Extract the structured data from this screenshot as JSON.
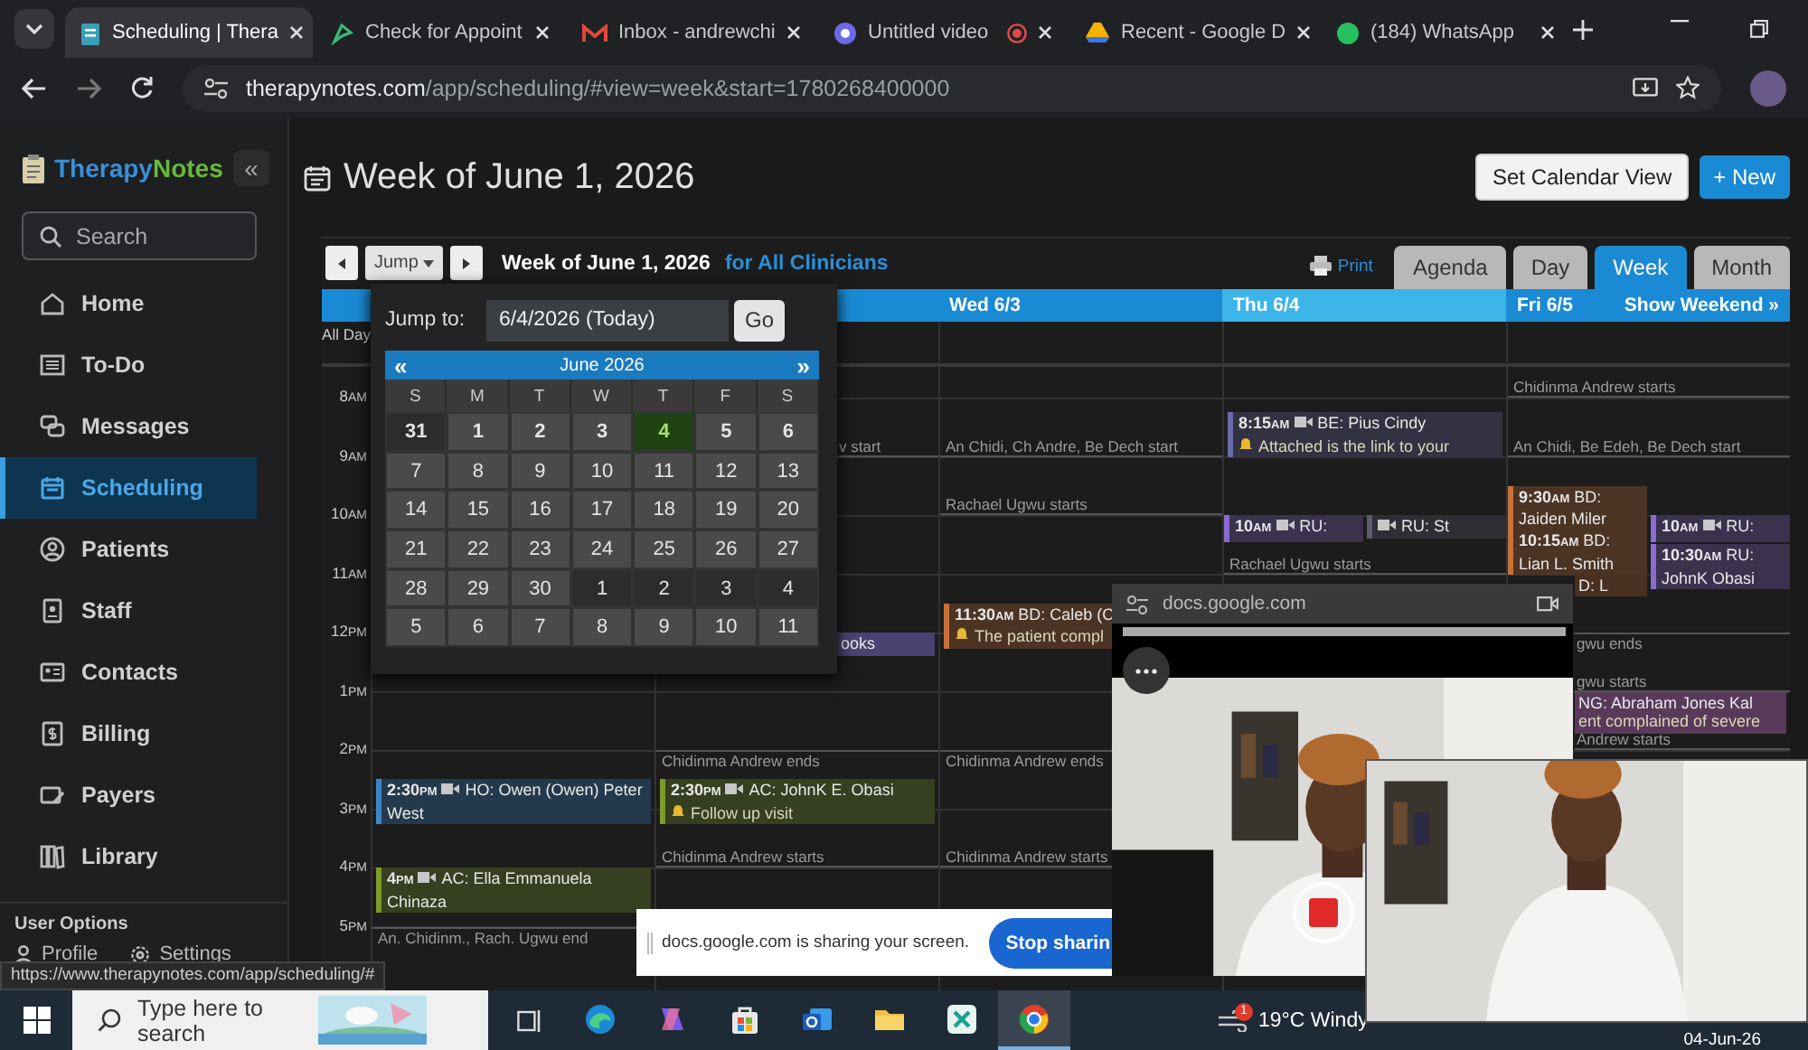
{
  "browser": {
    "tabs": [
      {
        "label": "Scheduling | Thera",
        "selected": true
      },
      {
        "label": "Check for Appoint",
        "selected": false
      },
      {
        "label": "Inbox - andrewchi",
        "selected": false
      },
      {
        "label": "Untitled video",
        "selected": false
      },
      {
        "label": "Recent - Google D",
        "selected": false
      },
      {
        "label": "(184) WhatsApp",
        "selected": false
      }
    ],
    "url_host": "therapynotes.com",
    "url_path": "/app/scheduling/#view=week&start=1780268400000"
  },
  "sidebar": {
    "logo": [
      "Therapy",
      "Notes"
    ],
    "collapse": "«",
    "search_placeholder": "Search",
    "items": [
      {
        "label": "Home",
        "selected": false
      },
      {
        "label": "To-Do",
        "selected": false
      },
      {
        "label": "Messages",
        "selected": false
      },
      {
        "label": "Scheduling",
        "selected": true
      },
      {
        "label": "Patients",
        "selected": false
      },
      {
        "label": "Staff",
        "selected": false
      },
      {
        "label": "Contacts",
        "selected": false
      },
      {
        "label": "Billing",
        "selected": false
      },
      {
        "label": "Payers",
        "selected": false
      },
      {
        "label": "Library",
        "selected": false
      }
    ],
    "section": "User Options",
    "links": [
      "Profile",
      "Settings"
    ]
  },
  "header": {
    "title": "Week of June 1, 2026",
    "buttons": [
      {
        "label": "Set Calendar View",
        "kind": "secondary"
      },
      {
        "label": "+ New",
        "kind": "primary"
      }
    ]
  },
  "calendar": {
    "jump": "Jump",
    "title": "Week of June 1, 2026",
    "scope": "for All Clinicians",
    "print": "Print",
    "views": [
      {
        "label": "Agenda",
        "selected": false
      },
      {
        "label": "Day",
        "selected": false
      },
      {
        "label": "Week",
        "selected": true
      },
      {
        "label": "Month",
        "selected": false
      }
    ],
    "days": [
      {
        "label": "Wed 6/3",
        "today": false
      },
      {
        "label": "Thu 6/4",
        "today": true
      },
      {
        "label": "Fri 6/5",
        "today": false
      }
    ],
    "show_weekend": "Show Weekend »",
    "all_day": "All Day",
    "hours": [
      {
        "hour": "8",
        "meridiem": "AM",
        "cells": {
          "column_4": [
            {
              "kind": "appt",
              "time": "8:15",
              "meridiem": "AM",
              "video": true,
              "title": "BE: Pius Cindy",
              "note": "Attached is the link to your",
              "color": "#6a6aa8",
              "clipped": false
            }
          ],
          "column_5": [
            {
              "kind": "start",
              "text": "Chidinma Andrew starts",
              "clipped": false
            }
          ]
        }
      },
      {
        "hour": "9",
        "meridiem": "AM",
        "cells": {
          "column_2": [
            {
              "kind": "start",
              "text": "v start",
              "clipped": true
            }
          ],
          "column_3": [
            {
              "kind": "start",
              "text": "An Chidi, Ch Andre, Be Dech start",
              "clipped": false
            }
          ],
          "column_5": [
            {
              "kind": "start",
              "text": "An Chidi, Be Edeh, Be Dech start",
              "clipped": false
            },
            {
              "kind": "overlap",
              "lanes": [
                [
                  {
                    "kind": "appt",
                    "time": "9:30",
                    "meridiem": "AM",
                    "video": false,
                    "title": "BD: Jaiden Miler",
                    "color": "#c8703a",
                    "clipped": false
                  },
                  {
                    "kind": "appt",
                    "time": "10:15",
                    "meridiem": "AM",
                    "video": false,
                    "title": "BD: Lian L. Smith",
                    "color": "#c8703a",
                    "clipped": false
                  },
                  {
                    "kind": "appt",
                    "video": false,
                    "title": "D: L",
                    "color": "#4a3020",
                    "clipped": true
                  }
                ],
                [
                  {
                    "kind": "appt",
                    "time": "10",
                    "meridiem": "AM",
                    "video": true,
                    "title": "RU:",
                    "color": "#8a6ad0",
                    "clipped": false
                  },
                  {
                    "kind": "appt",
                    "time": "10:30",
                    "meridiem": "AM",
                    "video": false,
                    "title": "RU: JohnK Obasi",
                    "color": "#8a6ad0",
                    "clipped": false
                  }
                ]
              ]
            }
          ]
        }
      },
      {
        "hour": "10",
        "meridiem": "AM",
        "cells": {
          "column_3": [
            {
              "kind": "start",
              "text": "Rachael Ugwu starts",
              "clipped": false
            }
          ],
          "column_4": [
            {
              "kind": "overlap",
              "lanes": [
                [
                  {
                    "kind": "appt",
                    "time": "10",
                    "meridiem": "AM",
                    "video": true,
                    "title": "RU:",
                    "color": "#8a6ad0",
                    "clipped": false
                  }
                ],
                [
                  {
                    "kind": "appt",
                    "video": true,
                    "title": "RU: St",
                    "color": "#5c5c72",
                    "clipped": false
                  }
                ]
              ]
            }
          ]
        }
      },
      {
        "hour": "11",
        "meridiem": "AM",
        "cells": {
          "column_3": [
            {
              "kind": "appt",
              "time": "11:30",
              "meridiem": "AM",
              "video": false,
              "title": "BD: Caleb (C",
              "note": "The patient compl",
              "color": "#c8703a",
              "clipped": false
            }
          ],
          "column_4": [
            {
              "kind": "start",
              "text": "Rachael Ugwu starts",
              "clipped": false
            }
          ]
        }
      },
      {
        "hour": "12",
        "meridiem": "PM",
        "cells": {
          "column_2": [
            {
              "kind": "appt",
              "video": false,
              "title": "ooks",
              "color": "#4a4270",
              "clipped": true
            }
          ],
          "column_5": [
            {
              "kind": "end",
              "text": "gwu ends",
              "clipped": true
            }
          ]
        }
      },
      {
        "hour": "1",
        "meridiem": "PM",
        "cells": {
          "column_5": [
            {
              "kind": "start",
              "text": "gwu starts",
              "clipped": true
            },
            {
              "kind": "appt",
              "video": false,
              "title": "NG: Abraham Jones Kal",
              "note": "ent complained of severe",
              "color": "#5a3a5a",
              "clipped": true
            }
          ]
        }
      },
      {
        "hour": "2",
        "meridiem": "PM",
        "cells": {
          "column_1": [
            {
              "kind": "appt",
              "time": "2:30",
              "meridiem": "PM",
              "video": true,
              "title": "HO: Owen (Owen) Peter West",
              "color": "#3a86c8",
              "clipped": false
            }
          ],
          "column_2": [
            {
              "kind": "end",
              "text": "Chidinma Andrew ends",
              "clipped": false
            },
            {
              "kind": "appt",
              "time": "2:30",
              "meridiem": "PM",
              "video": true,
              "title": "AC: JohnK E. Obasi",
              "note": "Follow up visit",
              "color": "#7a9a2a",
              "clipped": false
            }
          ],
          "column_3": [
            {
              "kind": "end",
              "text": "Chidinma Andrew ends",
              "clipped": false
            }
          ],
          "column_5": [
            {
              "kind": "start",
              "text": "Andrew starts",
              "clipped": true
            }
          ]
        }
      },
      {
        "hour": "3",
        "meridiem": "PM"
      },
      {
        "hour": "4",
        "meridiem": "PM",
        "cells": {
          "column_1": [
            {
              "kind": "appt",
              "time": "4",
              "meridiem": "PM",
              "video": true,
              "title": "AC: Ella Emmanuela Chinaza",
              "color": "#7a9a2a",
              "clipped": false
            }
          ],
          "column_2": [
            {
              "kind": "start",
              "text": "Chidinma Andrew starts",
              "clipped": false
            }
          ],
          "column_3": [
            {
              "kind": "start",
              "text": "Chidinma Andrew starts",
              "clipped": false
            }
          ]
        }
      },
      {
        "hour": "5",
        "meridiem": "PM",
        "cells": {
          "column_1": [
            {
              "kind": "end",
              "text": "An. Chidinm., Rach. Ugwu end",
              "clipped": false
            }
          ]
        }
      }
    ]
  },
  "jump_picker": {
    "label": "Jump to:",
    "value": "6/4/2026 (Today)",
    "go": "Go",
    "prev": "«",
    "next": "»",
    "month": "June 2026",
    "weekdays": [
      "S",
      "M",
      "T",
      "W",
      "T",
      "F",
      "S"
    ],
    "weeks": [
      {
        "current": true,
        "days": [
          {
            "day": "31",
            "outside": true,
            "selected": false
          },
          {
            "day": "1",
            "outside": false,
            "selected": false
          },
          {
            "day": "2",
            "outside": false,
            "selected": false
          },
          {
            "day": "3",
            "outside": false,
            "selected": false
          },
          {
            "day": "4",
            "outside": false,
            "selected": true
          },
          {
            "day": "5",
            "outside": false,
            "selected": false
          },
          {
            "day": "6",
            "outside": false,
            "selected": false
          }
        ]
      },
      {
        "current": false,
        "days": [
          {
            "day": "7",
            "outside": false,
            "selected": false
          },
          {
            "day": "8",
            "outside": false,
            "selected": false
          },
          {
            "day": "9",
            "outside": false,
            "selected": false
          },
          {
            "day": "10",
            "outside": false,
            "selected": false
          },
          {
            "day": "11",
            "outside": false,
            "selected": false
          },
          {
            "day": "12",
            "outside": false,
            "selected": false
          },
          {
            "day": "13",
            "outside": false,
            "selected": false
          }
        ]
      },
      {
        "current": false,
        "days": [
          {
            "day": "14",
            "outside": false,
            "selected": false
          },
          {
            "day": "15",
            "outside": false,
            "selected": false
          },
          {
            "day": "16",
            "outside": false,
            "selected": false
          },
          {
            "day": "17",
            "outside": false,
            "selected": false
          },
          {
            "day": "18",
            "outside": false,
            "selected": false
          },
          {
            "day": "19",
            "outside": false,
            "selected": false
          },
          {
            "day": "20",
            "outside": false,
            "selected": false
          }
        ]
      },
      {
        "current": false,
        "days": [
          {
            "day": "21",
            "outside": false,
            "selected": false
          },
          {
            "day": "22",
            "outside": false,
            "selected": false
          },
          {
            "day": "23",
            "outside": false,
            "selected": false
          },
          {
            "day": "24",
            "outside": false,
            "selected": false
          },
          {
            "day": "25",
            "outside": false,
            "selected": false
          },
          {
            "day": "26",
            "outside": false,
            "selected": false
          },
          {
            "day": "27",
            "outside": false,
            "selected": false
          }
        ]
      },
      {
        "current": false,
        "days": [
          {
            "day": "28",
            "outside": false,
            "selected": false
          },
          {
            "day": "29",
            "outside": false,
            "selected": false
          },
          {
            "day": "30",
            "outside": false,
            "selected": false
          },
          {
            "day": "1",
            "outside": true,
            "selected": false
          },
          {
            "day": "2",
            "outside": true,
            "selected": false
          },
          {
            "day": "3",
            "outside": true,
            "selected": false
          },
          {
            "day": "4",
            "outside": true,
            "selected": false
          }
        ]
      },
      {
        "current": false,
        "days": [
          {
            "day": "5",
            "outside": false,
            "selected": false
          },
          {
            "day": "6",
            "outside": false,
            "selected": false
          },
          {
            "day": "7",
            "outside": false,
            "selected": false
          },
          {
            "day": "8",
            "outside": false,
            "selected": false
          },
          {
            "day": "9",
            "outside": false,
            "selected": false
          },
          {
            "day": "10",
            "outside": false,
            "selected": false
          },
          {
            "day": "11",
            "outside": false,
            "selected": false
          }
        ]
      }
    ]
  },
  "video_window": {
    "host": "docs.google.com"
  },
  "share_bar": {
    "message": "docs.google.com is sharing your screen.",
    "button": "Stop sharin"
  },
  "status_url": "https://www.therapynotes.com/app/scheduling/#",
  "taskbar": {
    "search_placeholder": "Type here to search",
    "apps": [
      {
        "active": false
      },
      {
        "active": false
      },
      {
        "active": false
      },
      {
        "active": false
      },
      {
        "active": false
      },
      {
        "active": false
      },
      {
        "active": true
      }
    ],
    "weather_badge": "1",
    "weather": "19°C Windy",
    "date": "04-Jun-26"
  }
}
